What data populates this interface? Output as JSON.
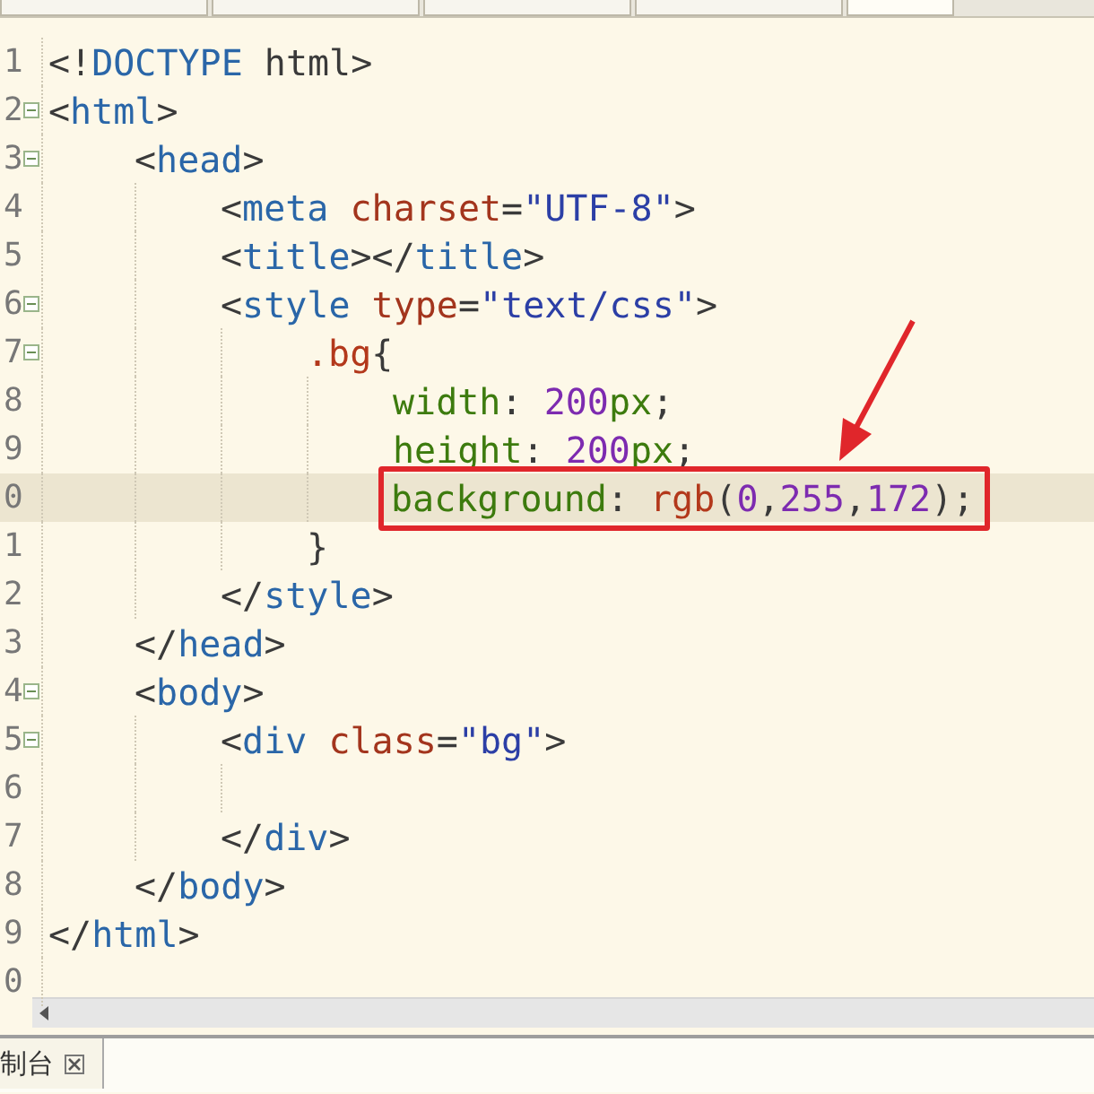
{
  "editor_tabs": [
    {
      "selected": false
    },
    {
      "selected": false
    },
    {
      "selected": false
    },
    {
      "selected": false
    },
    {
      "selected": true
    }
  ],
  "editor": {
    "lines": [
      {
        "number": "1",
        "fold": false,
        "highlighted": false,
        "boxed": false,
        "tokens": [
          {
            "text": "<!",
            "kind": "punct"
          },
          {
            "text": "DOCTYPE",
            "kind": "tag"
          },
          {
            "text": " html>",
            "kind": "punct"
          }
        ]
      },
      {
        "number": "2",
        "fold": true,
        "highlighted": false,
        "boxed": false,
        "tokens": [
          {
            "text": "<",
            "kind": "punct"
          },
          {
            "text": "html",
            "kind": "tag"
          },
          {
            "text": ">",
            "kind": "punct"
          }
        ],
        "children": [
          {
            "number": "3",
            "fold": true,
            "highlighted": false,
            "boxed": false,
            "tokens": [
              {
                "text": "<",
                "kind": "punct"
              },
              {
                "text": "head",
                "kind": "tag"
              },
              {
                "text": ">",
                "kind": "punct"
              }
            ],
            "children": [
              {
                "number": "4",
                "fold": false,
                "highlighted": false,
                "boxed": false,
                "tokens": [
                  {
                    "text": "<",
                    "kind": "punct"
                  },
                  {
                    "text": "meta",
                    "kind": "tag"
                  },
                  {
                    "text": " charset",
                    "kind": "attr"
                  },
                  {
                    "text": "=",
                    "kind": "punct"
                  },
                  {
                    "text": "\"UTF-8\"",
                    "kind": "string"
                  },
                  {
                    "text": ">",
                    "kind": "punct"
                  }
                ]
              },
              {
                "number": "5",
                "fold": false,
                "highlighted": false,
                "boxed": false,
                "tokens": [
                  {
                    "text": "<",
                    "kind": "punct"
                  },
                  {
                    "text": "title",
                    "kind": "tag"
                  },
                  {
                    "text": "></",
                    "kind": "punct"
                  },
                  {
                    "text": "title",
                    "kind": "tag"
                  },
                  {
                    "text": ">",
                    "kind": "punct"
                  }
                ]
              },
              {
                "number": "6",
                "fold": true,
                "highlighted": false,
                "boxed": false,
                "tokens": [
                  {
                    "text": "<",
                    "kind": "punct"
                  },
                  {
                    "text": "style",
                    "kind": "tag"
                  },
                  {
                    "text": " type",
                    "kind": "attr"
                  },
                  {
                    "text": "=",
                    "kind": "punct"
                  },
                  {
                    "text": "\"text/css\"",
                    "kind": "string"
                  },
                  {
                    "text": ">",
                    "kind": "punct"
                  }
                ],
                "children": [
                  {
                    "number": "7",
                    "fold": true,
                    "highlighted": false,
                    "boxed": false,
                    "tokens": [
                      {
                        "text": ".bg",
                        "kind": "selector"
                      },
                      {
                        "text": "{",
                        "kind": "punct"
                      }
                    ],
                    "children": [
                      {
                        "number": "8",
                        "fold": false,
                        "highlighted": false,
                        "boxed": false,
                        "tokens": [
                          {
                            "text": "width",
                            "kind": "property"
                          },
                          {
                            "text": ": ",
                            "kind": "punct"
                          },
                          {
                            "text": "200",
                            "kind": "number"
                          },
                          {
                            "text": "px",
                            "kind": "property"
                          },
                          {
                            "text": ";",
                            "kind": "punct"
                          }
                        ]
                      },
                      {
                        "number": "9",
                        "fold": false,
                        "highlighted": false,
                        "boxed": false,
                        "tokens": [
                          {
                            "text": "height",
                            "kind": "property"
                          },
                          {
                            "text": ": ",
                            "kind": "punct"
                          },
                          {
                            "text": "200",
                            "kind": "number"
                          },
                          {
                            "text": "px",
                            "kind": "property"
                          },
                          {
                            "text": ";",
                            "kind": "punct"
                          }
                        ]
                      },
                      {
                        "number": "0",
                        "fold": false,
                        "highlighted": true,
                        "boxed": true,
                        "tokens": [
                          {
                            "text": "background",
                            "kind": "property"
                          },
                          {
                            "text": ": ",
                            "kind": "punct"
                          },
                          {
                            "text": "rgb",
                            "kind": "selector"
                          },
                          {
                            "text": "(",
                            "kind": "punct"
                          },
                          {
                            "text": "0",
                            "kind": "number"
                          },
                          {
                            "text": ",",
                            "kind": "punct"
                          },
                          {
                            "text": "255",
                            "kind": "number"
                          },
                          {
                            "text": ",",
                            "kind": "punct"
                          },
                          {
                            "text": "172",
                            "kind": "number"
                          },
                          {
                            "text": ");",
                            "kind": "punct"
                          }
                        ]
                      }
                    ]
                  },
                  {
                    "number": "1",
                    "fold": false,
                    "highlighted": false,
                    "boxed": false,
                    "tokens": [
                      {
                        "text": "}",
                        "kind": "punct"
                      }
                    ]
                  }
                ]
              },
              {
                "number": "2",
                "fold": false,
                "highlighted": false,
                "boxed": false,
                "tokens": [
                  {
                    "text": "</",
                    "kind": "punct"
                  },
                  {
                    "text": "style",
                    "kind": "tag"
                  },
                  {
                    "text": ">",
                    "kind": "punct"
                  }
                ]
              }
            ]
          },
          {
            "number": "3",
            "fold": false,
            "highlighted": false,
            "boxed": false,
            "tokens": [
              {
                "text": "</",
                "kind": "punct"
              },
              {
                "text": "head",
                "kind": "tag"
              },
              {
                "text": ">",
                "kind": "punct"
              }
            ]
          },
          {
            "number": "4",
            "fold": true,
            "highlighted": false,
            "boxed": false,
            "tokens": [
              {
                "text": "<",
                "kind": "punct"
              },
              {
                "text": "body",
                "kind": "tag"
              },
              {
                "text": ">",
                "kind": "punct"
              }
            ],
            "children": [
              {
                "number": "5",
                "fold": true,
                "highlighted": false,
                "boxed": false,
                "tokens": [
                  {
                    "text": "<",
                    "kind": "punct"
                  },
                  {
                    "text": "div",
                    "kind": "tag"
                  },
                  {
                    "text": " class",
                    "kind": "attr"
                  },
                  {
                    "text": "=",
                    "kind": "punct"
                  },
                  {
                    "text": "\"bg\"",
                    "kind": "string"
                  },
                  {
                    "text": ">",
                    "kind": "punct"
                  }
                ],
                "children": [
                  {
                    "number": "6",
                    "fold": false,
                    "highlighted": false,
                    "boxed": false
                  }
                ]
              },
              {
                "number": "7",
                "fold": false,
                "highlighted": false,
                "boxed": false,
                "tokens": [
                  {
                    "text": "</",
                    "kind": "punct"
                  },
                  {
                    "text": "div",
                    "kind": "tag"
                  },
                  {
                    "text": ">",
                    "kind": "punct"
                  }
                ]
              }
            ]
          },
          {
            "number": "8",
            "fold": false,
            "highlighted": false,
            "boxed": false,
            "tokens": [
              {
                "text": "</",
                "kind": "punct"
              },
              {
                "text": "body",
                "kind": "tag"
              },
              {
                "text": ">",
                "kind": "punct"
              }
            ]
          }
        ]
      },
      {
        "number": "9",
        "fold": false,
        "highlighted": false,
        "boxed": false,
        "tokens": [
          {
            "text": "</",
            "kind": "punct"
          },
          {
            "text": "html",
            "kind": "tag"
          },
          {
            "text": ">",
            "kind": "punct"
          }
        ]
      },
      {
        "number": "0",
        "fold": false,
        "highlighted": false,
        "boxed": false
      }
    ]
  },
  "bottom_panel": {
    "tabs": [
      {
        "label": "制台",
        "closable": true
      }
    ]
  }
}
